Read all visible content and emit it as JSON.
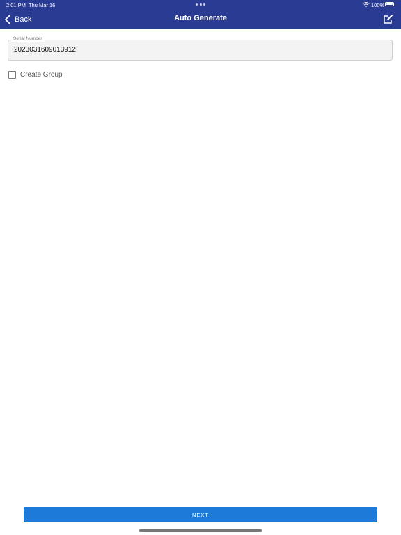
{
  "status_bar": {
    "time": "2:01 PM",
    "date": "Thu Mar 16",
    "battery": "100%",
    "wifi_icon": "wifi-icon",
    "battery_icon": "battery-icon"
  },
  "nav": {
    "back_label": "Back",
    "title": "Auto Generate",
    "back_icon": "chevron-left-icon",
    "edit_icon": "edit-icon",
    "background_color": "#2a3b93"
  },
  "form": {
    "serial_label": "Serial Number",
    "serial_value": "2023031609013912",
    "create_group_label": "Create Group",
    "create_group_checked": false
  },
  "footer": {
    "next_label": "NEXT",
    "button_color": "#1e7ad9"
  }
}
